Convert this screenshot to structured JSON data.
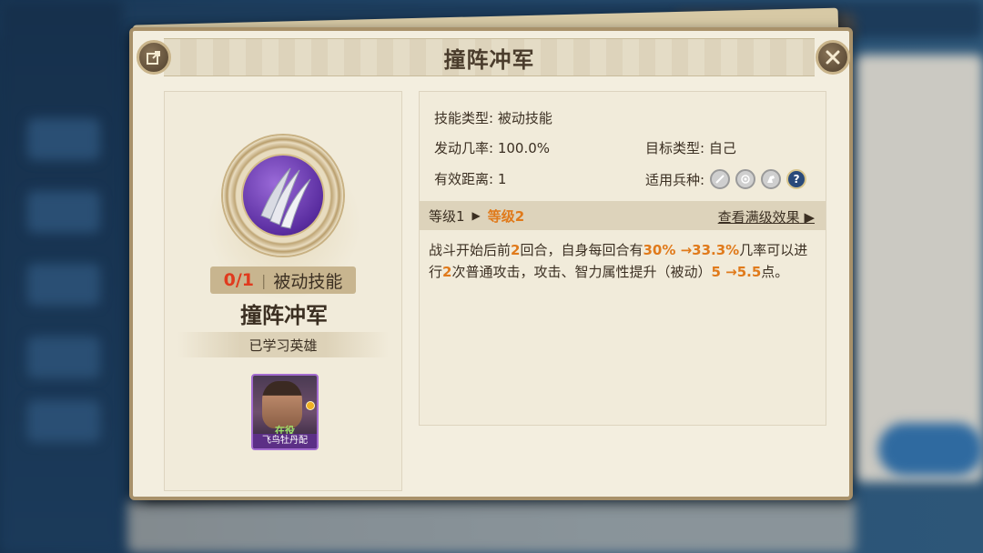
{
  "panel": {
    "title": "撞阵冲军",
    "share_icon": "share-icon",
    "close_icon": "close-icon"
  },
  "skill": {
    "count": "0/1",
    "category": "被动技能",
    "name": "撞阵冲军",
    "learned_label": "已学习英雄"
  },
  "hero": {
    "status": "在役",
    "name": "飞鸟牡丹配"
  },
  "info": {
    "type_label": "技能类型:",
    "type_value": "被动技能",
    "rate_label": "发动几率:",
    "rate_value": "100.0%",
    "target_label": "目标类型:",
    "target_value": "自己",
    "range_label": "有效距离:",
    "range_value": "1",
    "troops_label": "适用兵种:",
    "troop_icons": [
      "sword-icon",
      "target-icon",
      "horse-icon",
      "question-icon"
    ]
  },
  "level": {
    "current": "等级1",
    "next": "等级2",
    "full_effect": "查看满级效果"
  },
  "description": {
    "p1": "战斗开始后前",
    "rounds": "2",
    "p2": "回合，自身每回合有",
    "chance": "30% →33.3%",
    "p3": "几率可以进行",
    "attacks": "2",
    "p4": "次普通攻击，攻击、智力属性提升（被动）",
    "bonus": "5 →5.5",
    "p5": "点。"
  },
  "colors": {
    "highlight": "#e07a1b",
    "count_red": "#e03a1e",
    "panel_bg": "#f3eedf"
  }
}
